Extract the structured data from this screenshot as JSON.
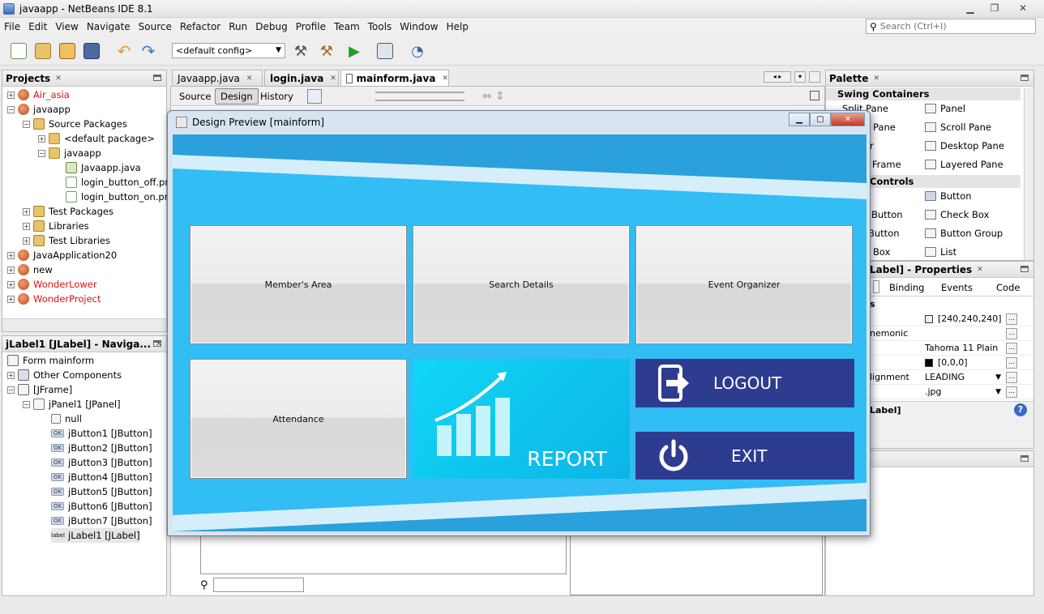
{
  "window": {
    "title": "javaapp - NetBeans IDE 8.1"
  },
  "menu": [
    "File",
    "Edit",
    "View",
    "Navigate",
    "Source",
    "Refactor",
    "Run",
    "Debug",
    "Profile",
    "Team",
    "Tools",
    "Window",
    "Help"
  ],
  "search": {
    "placeholder": "Search (Ctrl+I)"
  },
  "toolbar": {
    "config": "<default config>"
  },
  "projects": {
    "title": "Projects",
    "items": [
      {
        "label": "Air_asia"
      },
      {
        "label": "javaapp"
      },
      {
        "label": "Source Packages"
      },
      {
        "label": "<default package>"
      },
      {
        "label": "javaapp"
      },
      {
        "label": "Javaapp.java"
      },
      {
        "label": "login_button_off.png"
      },
      {
        "label": "login_button_on.png"
      },
      {
        "label": "Test Packages"
      },
      {
        "label": "Libraries"
      },
      {
        "label": "Test Libraries"
      },
      {
        "label": "JavaApplication20"
      },
      {
        "label": "new"
      },
      {
        "label": "WonderLower"
      },
      {
        "label": "WonderProject"
      }
    ]
  },
  "navigator": {
    "title": "jLabel1 [JLabel] - Naviga...",
    "items": [
      {
        "label": "Form mainform"
      },
      {
        "label": "Other Components"
      },
      {
        "label": "[JFrame]"
      },
      {
        "label": "jPanel1 [JPanel]"
      },
      {
        "label": "null"
      },
      {
        "label": "jButton1 [JButton]"
      },
      {
        "label": "jButton2 [JButton]"
      },
      {
        "label": "jButton3 [JButton]"
      },
      {
        "label": "jButton4 [JButton]"
      },
      {
        "label": "jButton5 [JButton]"
      },
      {
        "label": "jButton6 [JButton]"
      },
      {
        "label": "jButton7 [JButton]"
      },
      {
        "label": "jLabel1 [JLabel]"
      }
    ],
    "ok_badge": "OK",
    "label_badge": "label"
  },
  "editor": {
    "tabs": [
      {
        "label": "Javaapp.java"
      },
      {
        "label": "login.java"
      },
      {
        "label": "mainform.java"
      }
    ],
    "modes": [
      "Source",
      "Design",
      "History"
    ]
  },
  "preview": {
    "title": "Design Preview [mainform]",
    "buttons": {
      "members": "Member's Area",
      "search": "Search Details",
      "event": "Event Organizer",
      "attendance": "Attendance"
    },
    "report": "REPORT",
    "logout": "LOGOUT",
    "exit": "EXIT"
  },
  "palette": {
    "title": "Palette",
    "sections": [
      "Swing Containers",
      "Controls"
    ],
    "items": [
      "Split Pane",
      "Panel",
      "Pane",
      "Scroll Pane",
      "r",
      "Desktop Pane",
      "l Frame",
      "Layered Pane",
      "Button",
      "Button",
      "Check Box",
      "Button",
      "Button Group",
      "Box",
      "List"
    ]
  },
  "properties": {
    "title": "Label] - Properties",
    "tabs": [
      "Binding",
      "Events",
      "Code"
    ],
    "section": "s",
    "rows": [
      {
        "name": "",
        "value": "[240,240,240]"
      },
      {
        "name": "nemonic",
        "value": ""
      },
      {
        "name": "",
        "value": "Tahoma 11 Plain"
      },
      {
        "name": "",
        "value": "[0,0,0]"
      },
      {
        "name": "lignment",
        "value": "LEADING"
      },
      {
        "name": "",
        "value": ".jpg"
      }
    ],
    "footer": "Label]"
  },
  "colors": {
    "form_bg": "#33bdf5",
    "tile_dark": "#2e3c8f",
    "report_tile": "#12d6f5"
  }
}
